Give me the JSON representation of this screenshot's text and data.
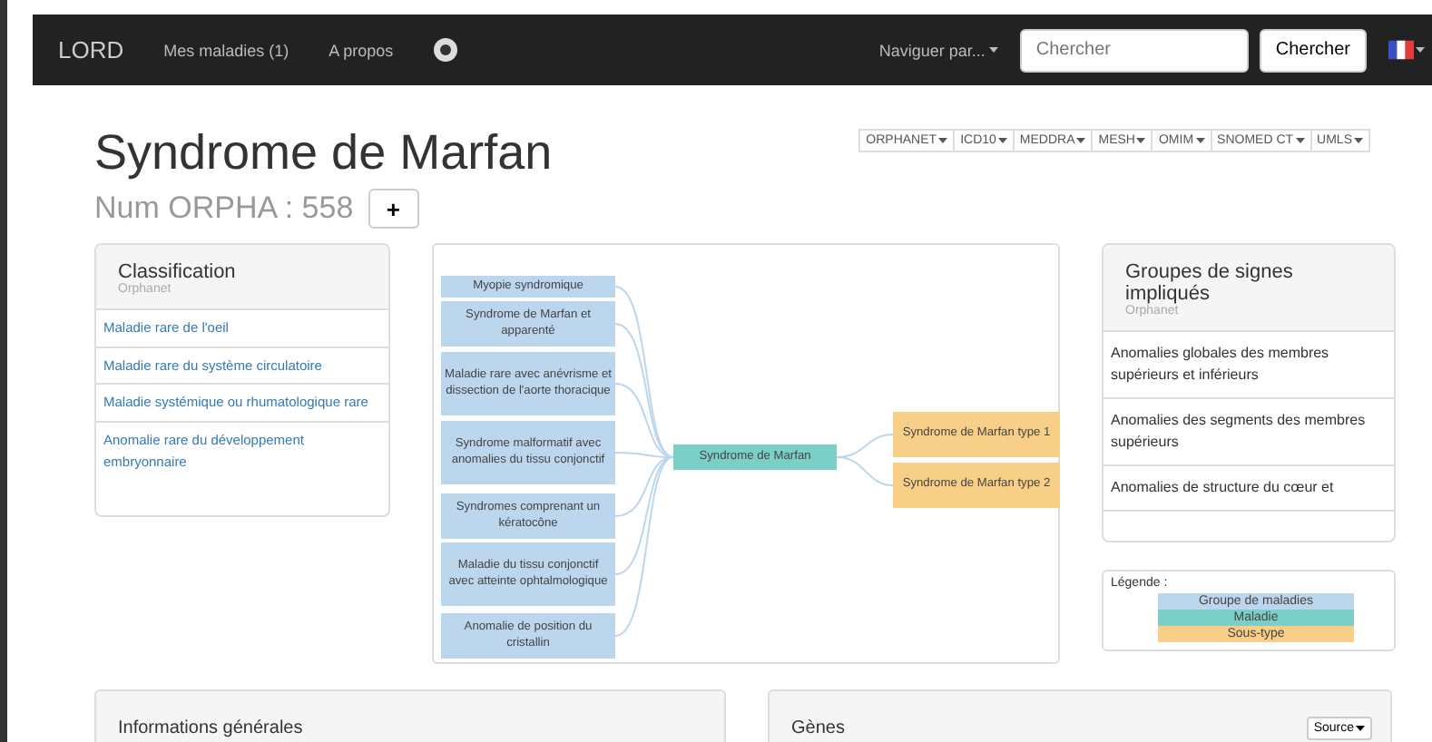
{
  "navbar": {
    "brand": "LORD",
    "links": [
      {
        "label": "Mes maladies (1)"
      },
      {
        "label": "A propos"
      }
    ],
    "browse": "Naviguer par...",
    "search": {
      "placeholder": "Chercher"
    },
    "search_button": "Chercher"
  },
  "title": "Syndrome de Marfan",
  "subtitle": "Num ORPHA : 558",
  "add_button": "+",
  "terminologies": [
    "ORPHANET",
    "ICD10",
    "MEDDRA",
    "MESH",
    "OMIM",
    "SNOMED CT",
    "UMLS"
  ],
  "classification": {
    "title": "Classification",
    "source": "Orphanet",
    "items": [
      "Maladie rare de l'oeil",
      "Maladie rare du système circulatoire",
      "Maladie systémique ou rhumatologique rare",
      "Anomalie rare du développement embryonnaire"
    ]
  },
  "graph": {
    "parents": [
      {
        "label": "Myopie syndromique",
        "kind": "group"
      },
      {
        "label": "Syndrome de Marfan et apparenté",
        "kind": "group"
      },
      {
        "label": "Maladie rare avec anévrisme et dissection de l'aorte thoracique",
        "kind": "group"
      },
      {
        "label": "Syndrome malformatif avec anomalies du tissu conjonctif",
        "kind": "group"
      },
      {
        "label": "Syndromes comprenant un kératocône",
        "kind": "group"
      },
      {
        "label": "Maladie du tissu conjonctif avec atteinte ophtalmologique",
        "kind": "group"
      },
      {
        "label": "Anomalie de position du cristallin",
        "kind": "group"
      }
    ],
    "center": {
      "label": "Syndrome de Marfan",
      "kind": "disease"
    },
    "children": [
      {
        "label": "Syndrome de Marfan type 1",
        "kind": "subtype"
      },
      {
        "label": "Syndrome de Marfan type 2",
        "kind": "subtype"
      }
    ]
  },
  "signs": {
    "title": "Groupes de signes impliqués",
    "source": "Orphanet",
    "items": [
      "Anomalies globales des membres supérieurs et inférieurs",
      "Anomalies des segments des membres supérieurs",
      "Anomalies de structure du cœur et"
    ]
  },
  "legend": {
    "title": "Légende :",
    "items": [
      {
        "label": "Groupe de maladies",
        "color": "#bcd6ee"
      },
      {
        "label": "Maladie",
        "color": "#7ccfc6"
      },
      {
        "label": "Sous-type",
        "color": "#f8cf86"
      }
    ]
  },
  "bottom_panels": [
    {
      "title": "Informations générales"
    },
    {
      "title": "Gènes",
      "button": "Source"
    }
  ]
}
